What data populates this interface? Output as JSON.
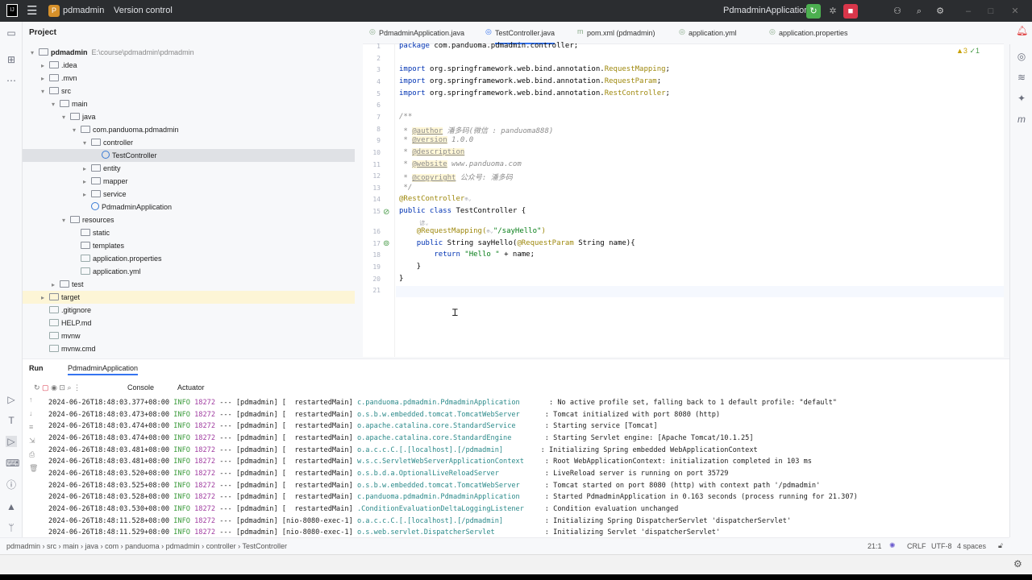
{
  "titlebar": {
    "project": "pdmadmin",
    "vcs": "Version control",
    "run_config": "PdmadminApplication"
  },
  "project_panel": {
    "title": "Project",
    "tree": [
      {
        "label": "pdmadmin",
        "hint": "E:\\course\\pdmadmin\\pdmadmin",
        "depth": 0,
        "arrow": "▾",
        "icon": "folder",
        "bold": true
      },
      {
        "label": ".idea",
        "depth": 1,
        "arrow": "▸",
        "icon": "folder"
      },
      {
        "label": ".mvn",
        "depth": 1,
        "arrow": "▸",
        "icon": "folder"
      },
      {
        "label": "src",
        "depth": 1,
        "arrow": "▾",
        "icon": "folder"
      },
      {
        "label": "main",
        "depth": 2,
        "arrow": "▾",
        "icon": "folder"
      },
      {
        "label": "java",
        "depth": 3,
        "arrow": "▾",
        "icon": "folder"
      },
      {
        "label": "com.panduoma.pdmadmin",
        "depth": 4,
        "arrow": "▾",
        "icon": "folder"
      },
      {
        "label": "controller",
        "depth": 5,
        "arrow": "▾",
        "icon": "folder"
      },
      {
        "label": "TestController",
        "depth": 6,
        "arrow": "",
        "icon": "cls",
        "selected": true
      },
      {
        "label": "entity",
        "depth": 5,
        "arrow": "▸",
        "icon": "folder"
      },
      {
        "label": "mapper",
        "depth": 5,
        "arrow": "▸",
        "icon": "folder"
      },
      {
        "label": "service",
        "depth": 5,
        "arrow": "▸",
        "icon": "folder"
      },
      {
        "label": "PdmadminApplication",
        "depth": 5,
        "arrow": "",
        "icon": "cls"
      },
      {
        "label": "resources",
        "depth": 3,
        "arrow": "▾",
        "icon": "folder"
      },
      {
        "label": "static",
        "depth": 4,
        "arrow": "",
        "icon": "folder"
      },
      {
        "label": "templates",
        "depth": 4,
        "arrow": "",
        "icon": "folder"
      },
      {
        "label": "application.properties",
        "depth": 4,
        "arrow": "",
        "icon": "file"
      },
      {
        "label": "application.yml",
        "depth": 4,
        "arrow": "",
        "icon": "file"
      },
      {
        "label": "test",
        "depth": 2,
        "arrow": "▸",
        "icon": "folder"
      },
      {
        "label": "target",
        "depth": 1,
        "arrow": "▸",
        "icon": "folder",
        "highlight": true
      },
      {
        "label": ".gitignore",
        "depth": 1,
        "arrow": "",
        "icon": "file"
      },
      {
        "label": "HELP.md",
        "depth": 1,
        "arrow": "",
        "icon": "file"
      },
      {
        "label": "mvnw",
        "depth": 1,
        "arrow": "",
        "icon": "file"
      },
      {
        "label": "mvnw.cmd",
        "depth": 1,
        "arrow": "",
        "icon": "file"
      }
    ]
  },
  "tabs": [
    "PdmadminApplication.java",
    "TestController.java",
    "pom.xml (pdmadmin)",
    "application.yml",
    "application.properties"
  ],
  "inspections": {
    "warnings": "3",
    "weak": "1"
  },
  "code": [
    {
      "n": "1",
      "t": [
        [
          "kw",
          "package "
        ],
        [
          "",
          "com.panduoma.pdmadmin.controller;"
        ]
      ]
    },
    {
      "n": "2",
      "t": []
    },
    {
      "n": "3",
      "t": [
        [
          "kw",
          "import "
        ],
        [
          "",
          "org.springframework.web.bind.annotation."
        ],
        [
          "pkg",
          "RequestMapping"
        ],
        [
          "",
          ";"
        ]
      ]
    },
    {
      "n": "4",
      "t": [
        [
          "kw",
          "import "
        ],
        [
          "",
          "org.springframework.web.bind.annotation."
        ],
        [
          "pkg",
          "RequestParam"
        ],
        [
          "",
          ";"
        ]
      ]
    },
    {
      "n": "5",
      "t": [
        [
          "kw",
          "import "
        ],
        [
          "",
          "org.springframework.web.bind.annotation."
        ],
        [
          "pkg",
          "RestController"
        ],
        [
          "",
          ";"
        ]
      ]
    },
    {
      "n": "6",
      "t": []
    },
    {
      "n": "7",
      "t": [
        [
          "cm",
          "/**"
        ]
      ]
    },
    {
      "n": "8",
      "t": [
        [
          "cm",
          " * "
        ],
        [
          "tag",
          "@author"
        ],
        [
          "cm",
          " 潘多码(微信 : panduoma888)"
        ]
      ]
    },
    {
      "n": "9",
      "t": [
        [
          "cm",
          " * "
        ],
        [
          "tag",
          "@version"
        ],
        [
          "cm",
          " 1.0.0"
        ]
      ]
    },
    {
      "n": "10",
      "t": [
        [
          "cm",
          " * "
        ],
        [
          "tag",
          "@description"
        ]
      ]
    },
    {
      "n": "11",
      "t": [
        [
          "cm",
          " * "
        ],
        [
          "tag",
          "@website"
        ],
        [
          "cm",
          " www.panduoma.com"
        ]
      ]
    },
    {
      "n": "12",
      "t": [
        [
          "cm",
          " * "
        ],
        [
          "tag",
          "@copyright"
        ],
        [
          "cm",
          " 公众号: 潘多码"
        ]
      ]
    },
    {
      "n": "13",
      "t": [
        [
          "cm",
          " */"
        ]
      ]
    },
    {
      "n": "14",
      "t": [
        [
          "ann",
          "@RestController"
        ],
        [
          "mut",
          "⊕⌄"
        ]
      ]
    },
    {
      "n": "15",
      "t": [
        [
          "kw",
          "public class "
        ],
        [
          "",
          "TestController {"
        ]
      ]
    },
    {
      "n": "",
      "t": [
        [
          "mut",
          "      谚⌄"
        ]
      ]
    },
    {
      "n": "16",
      "t": [
        [
          "",
          "    "
        ],
        [
          "ann",
          "@RequestMapping("
        ],
        [
          "mut",
          "⊕⌄"
        ],
        [
          "str",
          "\"/sayHello\""
        ],
        [
          "ann",
          ")"
        ]
      ]
    },
    {
      "n": "17",
      "t": [
        [
          "",
          "    "
        ],
        [
          "kw",
          "public "
        ],
        [
          "",
          "String sayHello("
        ],
        [
          "ann",
          "@RequestParam"
        ],
        [
          "",
          " String name){"
        ]
      ]
    },
    {
      "n": "18",
      "t": [
        [
          "",
          "        "
        ],
        [
          "kw",
          "return "
        ],
        [
          "str",
          "\"Hello \""
        ],
        [
          "",
          " + name;"
        ]
      ]
    },
    {
      "n": "19",
      "t": [
        [
          "",
          "    }"
        ]
      ]
    },
    {
      "n": "20",
      "t": [
        [
          "",
          "}"
        ]
      ]
    },
    {
      "n": "21",
      "t": []
    }
  ],
  "run": {
    "title": "Run",
    "config": "PdmadminApplication",
    "tabs": [
      "Console",
      "Actuator"
    ],
    "logs": [
      {
        "ts": "2024-06-26T18:48:03.377+08:00",
        "lvl": "INFO",
        "pid": "18272",
        "app": "--- [pdmadmin] [  restartedMain]",
        "logger": "c.panduoma.pdmadmin.PdmadminApplication      ",
        "msg": ": No active profile set, falling back to 1 default profile: \"default\""
      },
      {
        "ts": "2024-06-26T18:48:03.473+08:00",
        "lvl": "INFO",
        "pid": "18272",
        "app": "--- [pdmadmin] [  restartedMain]",
        "logger": "o.s.b.w.embedded.tomcat.TomcatWebServer     ",
        "msg": ": Tomcat initialized with port 8080 (http)"
      },
      {
        "ts": "2024-06-26T18:48:03.474+08:00",
        "lvl": "INFO",
        "pid": "18272",
        "app": "--- [pdmadmin] [  restartedMain]",
        "logger": "o.apache.catalina.core.StandardService      ",
        "msg": ": Starting service [Tomcat]"
      },
      {
        "ts": "2024-06-26T18:48:03.474+08:00",
        "lvl": "INFO",
        "pid": "18272",
        "app": "--- [pdmadmin] [  restartedMain]",
        "logger": "o.apache.catalina.core.StandardEngine       ",
        "msg": ": Starting Servlet engine: [Apache Tomcat/10.1.25]"
      },
      {
        "ts": "2024-06-26T18:48:03.481+08:00",
        "lvl": "INFO",
        "pid": "18272",
        "app": "--- [pdmadmin] [  restartedMain]",
        "logger": "o.a.c.c.C.[.[localhost].[/pdmadmin]        ",
        "msg": ": Initializing Spring embedded WebApplicationContext"
      },
      {
        "ts": "2024-06-26T18:48:03.481+08:00",
        "lvl": "INFO",
        "pid": "18272",
        "app": "--- [pdmadmin] [  restartedMain]",
        "logger": "w.s.c.ServletWebServerApplicationContext    ",
        "msg": ": Root WebApplicationContext: initialization completed in 103 ms"
      },
      {
        "ts": "2024-06-26T18:48:03.520+08:00",
        "lvl": "INFO",
        "pid": "18272",
        "app": "--- [pdmadmin] [  restartedMain]",
        "logger": "o.s.b.d.a.OptionalLiveReloadServer          ",
        "msg": ": LiveReload server is running on port 35729"
      },
      {
        "ts": "2024-06-26T18:48:03.525+08:00",
        "lvl": "INFO",
        "pid": "18272",
        "app": "--- [pdmadmin] [  restartedMain]",
        "logger": "o.s.b.w.embedded.tomcat.TomcatWebServer     ",
        "msg": ": Tomcat started on port 8080 (http) with context path '/pdmadmin'"
      },
      {
        "ts": "2024-06-26T18:48:03.528+08:00",
        "lvl": "INFO",
        "pid": "18272",
        "app": "--- [pdmadmin] [  restartedMain]",
        "logger": "c.panduoma.pdmadmin.PdmadminApplication     ",
        "msg": ": Started PdmadminApplication in 0.163 seconds (process running for 21.307)"
      },
      {
        "ts": "2024-06-26T18:48:03.530+08:00",
        "lvl": "INFO",
        "pid": "18272",
        "app": "--- [pdmadmin] [  restartedMain]",
        "logger": ".ConditionEvaluationDeltaLoggingListener    ",
        "msg": ": Condition evaluation unchanged"
      },
      {
        "ts": "2024-06-26T18:48:11.528+08:00",
        "lvl": "INFO",
        "pid": "18272",
        "app": "--- [pdmadmin] [nio-8080-exec-1]",
        "logger": "o.a.c.c.C.[.[localhost].[/pdmadmin]         ",
        "msg": ": Initializing Spring DispatcherServlet 'dispatcherServlet'"
      },
      {
        "ts": "2024-06-26T18:48:11.529+08:00",
        "lvl": "INFO",
        "pid": "18272",
        "app": "--- [pdmadmin] [nio-8080-exec-1]",
        "logger": "o.s.web.servlet.DispatcherServlet           ",
        "msg": ": Initializing Servlet 'dispatcherServlet'"
      }
    ]
  },
  "breadcrumb": [
    "pdmadmin",
    "src",
    "main",
    "java",
    "com",
    "panduoma",
    "pdmadmin",
    "controller",
    "TestController"
  ],
  "status": {
    "position": "21:1",
    "line_sep": "CRLF",
    "encoding": "UTF-8",
    "indent": "4 spaces"
  }
}
